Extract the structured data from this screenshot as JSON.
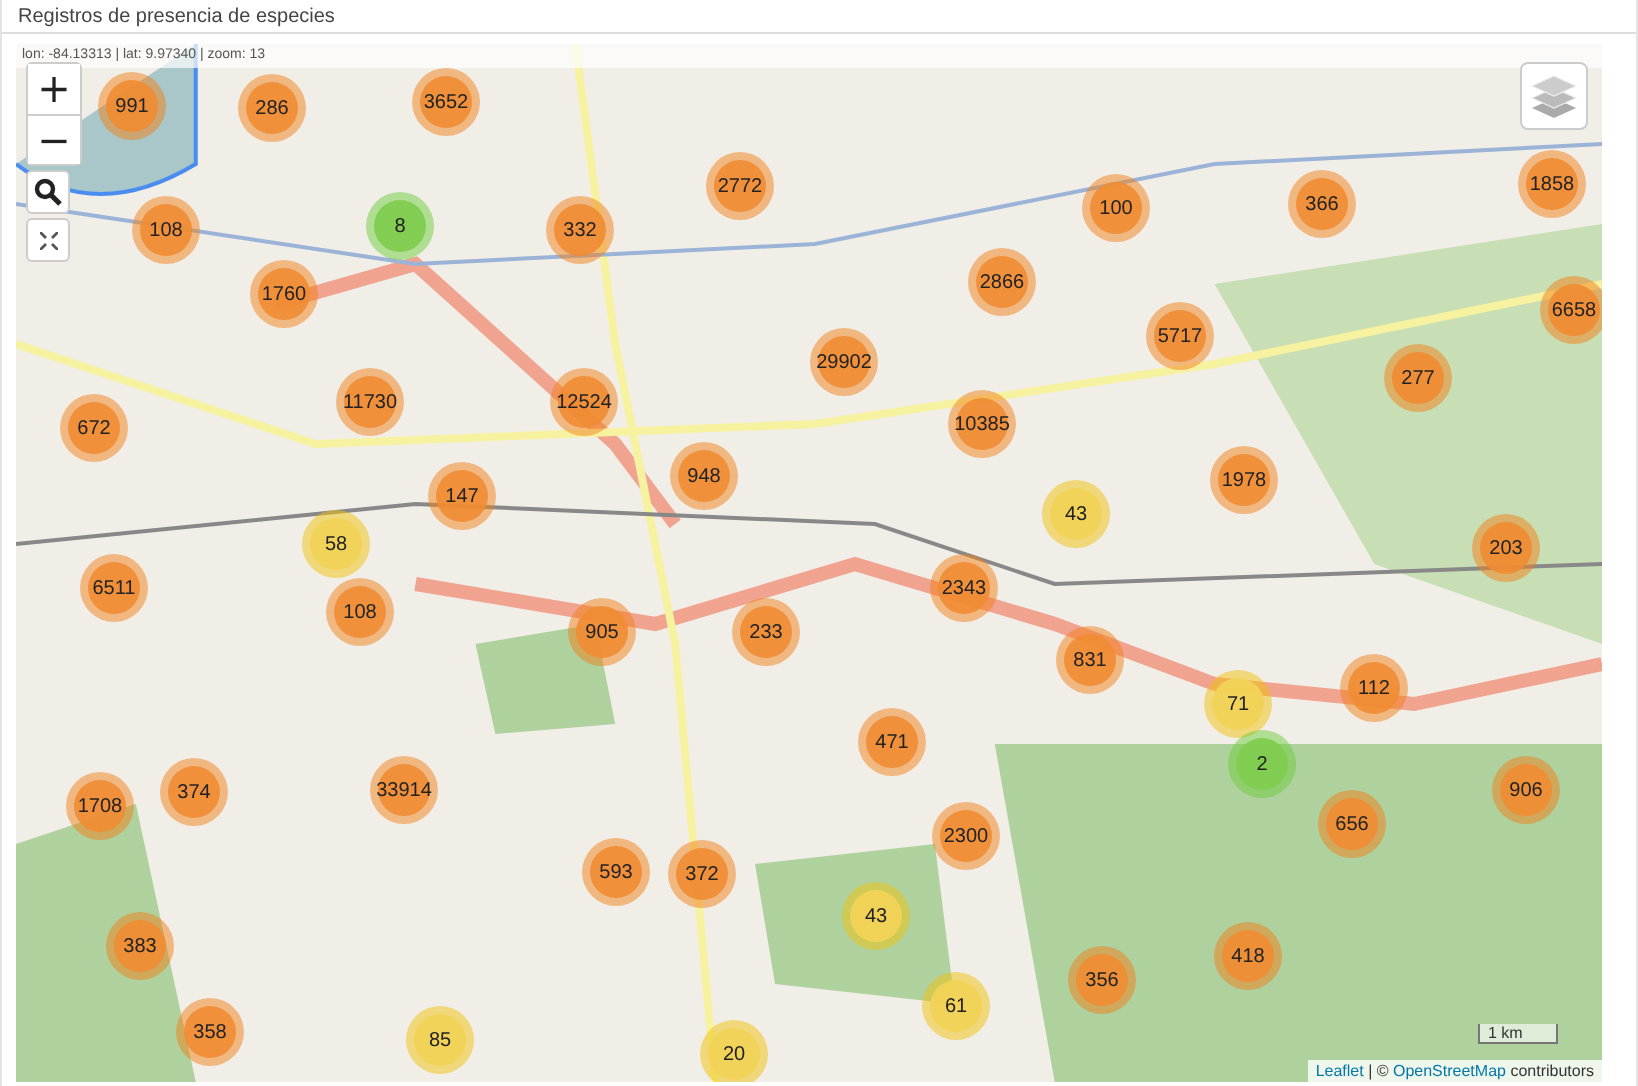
{
  "panel": {
    "title": "Registros de presencia de especies"
  },
  "map": {
    "coordinates": "lon: -84.13313 | lat: 9.97340 | zoom: 13",
    "zoom_in": "+",
    "zoom_out": "−",
    "scale": "1 km",
    "attribution": {
      "links": [
        "Leaflet",
        "OpenStreetMap"
      ],
      "separator": "| ©",
      "suffix": "contributors"
    },
    "clusters": [
      {
        "count": "991",
        "kind": "large"
      },
      {
        "count": "286",
        "kind": "large"
      },
      {
        "count": "3652",
        "kind": "large"
      },
      {
        "count": "108",
        "kind": "large"
      },
      {
        "count": "8",
        "kind": "small"
      },
      {
        "count": "332",
        "kind": "large"
      },
      {
        "count": "2772",
        "kind": "large"
      },
      {
        "count": "100",
        "kind": "large"
      },
      {
        "count": "366",
        "kind": "large"
      },
      {
        "count": "1858",
        "kind": "large"
      },
      {
        "count": "1760",
        "kind": "large"
      },
      {
        "count": "2866",
        "kind": "large"
      },
      {
        "count": "5717",
        "kind": "large"
      },
      {
        "count": "6658",
        "kind": "large"
      },
      {
        "count": "29902",
        "kind": "large"
      },
      {
        "count": "11730",
        "kind": "large"
      },
      {
        "count": "12524",
        "kind": "large"
      },
      {
        "count": "277",
        "kind": "large"
      },
      {
        "count": "672",
        "kind": "large"
      },
      {
        "count": "10385",
        "kind": "large"
      },
      {
        "count": "1978",
        "kind": "large"
      },
      {
        "count": "147",
        "kind": "large"
      },
      {
        "count": "948",
        "kind": "large"
      },
      {
        "count": "58",
        "kind": "medium"
      },
      {
        "count": "43",
        "kind": "medium"
      },
      {
        "count": "203",
        "kind": "large"
      },
      {
        "count": "6511",
        "kind": "large"
      },
      {
        "count": "108",
        "kind": "large"
      },
      {
        "count": "905",
        "kind": "large"
      },
      {
        "count": "233",
        "kind": "large"
      },
      {
        "count": "2343",
        "kind": "large"
      },
      {
        "count": "831",
        "kind": "large"
      },
      {
        "count": "71",
        "kind": "medium"
      },
      {
        "count": "112",
        "kind": "large"
      },
      {
        "count": "2",
        "kind": "small"
      },
      {
        "count": "1708",
        "kind": "large"
      },
      {
        "count": "374",
        "kind": "large"
      },
      {
        "count": "33914",
        "kind": "large"
      },
      {
        "count": "471",
        "kind": "large"
      },
      {
        "count": "906",
        "kind": "large"
      },
      {
        "count": "656",
        "kind": "large"
      },
      {
        "count": "2300",
        "kind": "large"
      },
      {
        "count": "593",
        "kind": "large"
      },
      {
        "count": "372",
        "kind": "large"
      },
      {
        "count": "43",
        "kind": "medium"
      },
      {
        "count": "383",
        "kind": "large"
      },
      {
        "count": "418",
        "kind": "large"
      },
      {
        "count": "356",
        "kind": "large"
      },
      {
        "count": "358",
        "kind": "large"
      },
      {
        "count": "61",
        "kind": "medium"
      },
      {
        "count": "85",
        "kind": "medium"
      },
      {
        "count": "20",
        "kind": "medium"
      }
    ]
  }
}
